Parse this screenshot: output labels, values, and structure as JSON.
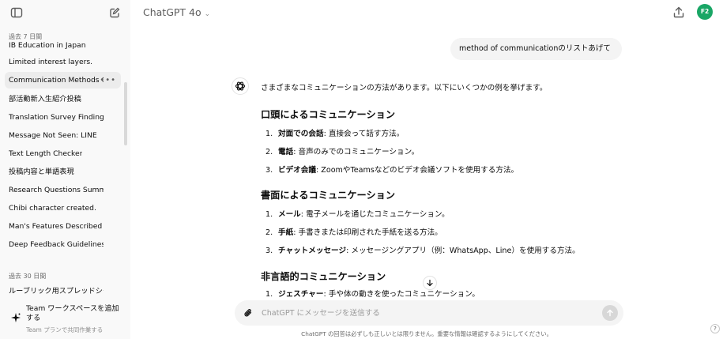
{
  "sidebar": {
    "groups": [
      {
        "label": "過去 7 日間"
      },
      {
        "label": "過去 30 日間"
      }
    ],
    "items": [
      {
        "label": "IB Education in Japan"
      },
      {
        "label": "Limited interest layers."
      },
      {
        "label": "Communication Methods Ov",
        "more": "•••"
      },
      {
        "label": "部活動新入生紹介投稿"
      },
      {
        "label": "Translation Survey Findings"
      },
      {
        "label": "Message Not Seen: LINE"
      },
      {
        "label": "Text Length Checker"
      },
      {
        "label": "投稿内容と単語表現"
      },
      {
        "label": "Research Questions Summary"
      },
      {
        "label": "Chibi character created."
      },
      {
        "label": "Man's Features Described"
      },
      {
        "label": "Deep Feedback Guidelines"
      },
      {
        "label": "ルーブリック用スプレッドシート"
      }
    ],
    "team": {
      "title": "Team ワークスペースを追加する",
      "subtitle": "Team プランで共同作業する"
    }
  },
  "header": {
    "model": "ChatGPT 4o",
    "avatar": "F2"
  },
  "conversation": {
    "user_message": "method of communicationのリストあげて",
    "intro": "さまざまなコミュニケーションの方法があります。以下にいくつかの例を挙げます。",
    "sections": [
      {
        "heading": "口頭によるコミュニケーション",
        "items": [
          {
            "num": "1.",
            "term": "対面での会話",
            "desc": ": 直接会って話す方法。"
          },
          {
            "num": "2.",
            "term": "電話",
            "desc": ": 音声のみでのコミュニケーション。"
          },
          {
            "num": "3.",
            "term": "ビデオ会議",
            "desc": ": ZoomやTeamsなどのビデオ会議ソフトを使用する方法。"
          }
        ]
      },
      {
        "heading": "書面によるコミュニケーション",
        "items": [
          {
            "num": "1.",
            "term": "メール",
            "desc": ": 電子メールを通じたコミュニケーション。"
          },
          {
            "num": "2.",
            "term": "手紙",
            "desc": ": 手書きまたは印刷された手紙を送る方法。"
          },
          {
            "num": "3.",
            "term": "チャットメッセージ",
            "desc": ": メッセージングアプリ（例：WhatsApp、Line）を使用する方法。"
          }
        ]
      },
      {
        "heading": "非言語的コミュニケーション",
        "items": [
          {
            "num": "1.",
            "term": "ジェスチャー",
            "desc": ": 手や体の動きを使ったコミュニケーション。"
          }
        ]
      }
    ]
  },
  "composer": {
    "placeholder": "ChatGPT にメッセージを送信する",
    "value": ""
  },
  "footer": {
    "disclaimer": "ChatGPT の回答は必ずしも正しいとは限りません。重要な情報は確認するようにしてください。",
    "help": "?"
  },
  "icons": {
    "sidebar_toggle": "sidebar-toggle-icon",
    "new_chat": "edit-icon",
    "share": "share-icon",
    "attach": "paperclip-icon",
    "send": "arrow-up-icon",
    "scroll_down": "arrow-down-icon",
    "assistant": "openai-logo-icon",
    "team": "sparkle-icon"
  },
  "colors": {
    "sidebar_bg": "#f9f9f9",
    "active_item": "#ececec",
    "avatar_bg": "#19a665",
    "bubble_bg": "#f4f4f4"
  }
}
